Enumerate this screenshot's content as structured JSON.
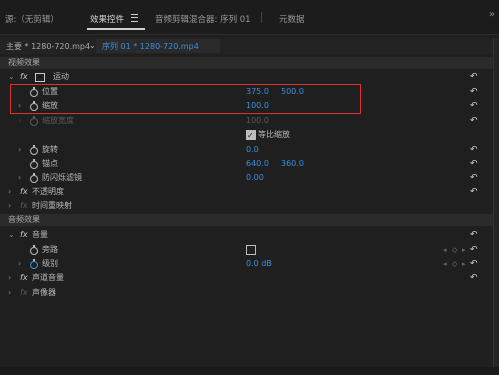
{
  "tabs": {
    "source": "源:（无剪辑）",
    "effect_controls": "效果控件",
    "audio_mixer": "音频剪辑混合器: 序列 01",
    "metadata": "元数据"
  },
  "clip_bar": {
    "master": "主要 * 1280-720.mp4",
    "sequence": "序列 01 * 1280-720.mp4"
  },
  "video_section": "视频效果",
  "motion": {
    "label": "运动",
    "position": {
      "label": "位置",
      "x": "375.0",
      "y": "500.0"
    },
    "scale": {
      "label": "缩放",
      "value": "100.0"
    },
    "scale_width": {
      "label": "缩放宽度",
      "value": "100.0"
    },
    "uniform_scale": {
      "label": "等比缩放",
      "checked": true
    },
    "rotation": {
      "label": "旋转",
      "value": "0.0"
    },
    "anchor": {
      "label": "锚点",
      "x": "640.0",
      "y": "360.0"
    },
    "antiflicker": {
      "label": "防闪烁滤镜",
      "value": "0.00"
    }
  },
  "opacity": "不透明度",
  "time_remap": "时间重映射",
  "audio_section": "音频效果",
  "volume": {
    "label": "音量",
    "bypass": {
      "label": "旁路"
    },
    "level": {
      "label": "级别",
      "value": "0.0 dB"
    }
  },
  "channel_volume": "声道音量",
  "panner": "声像器"
}
